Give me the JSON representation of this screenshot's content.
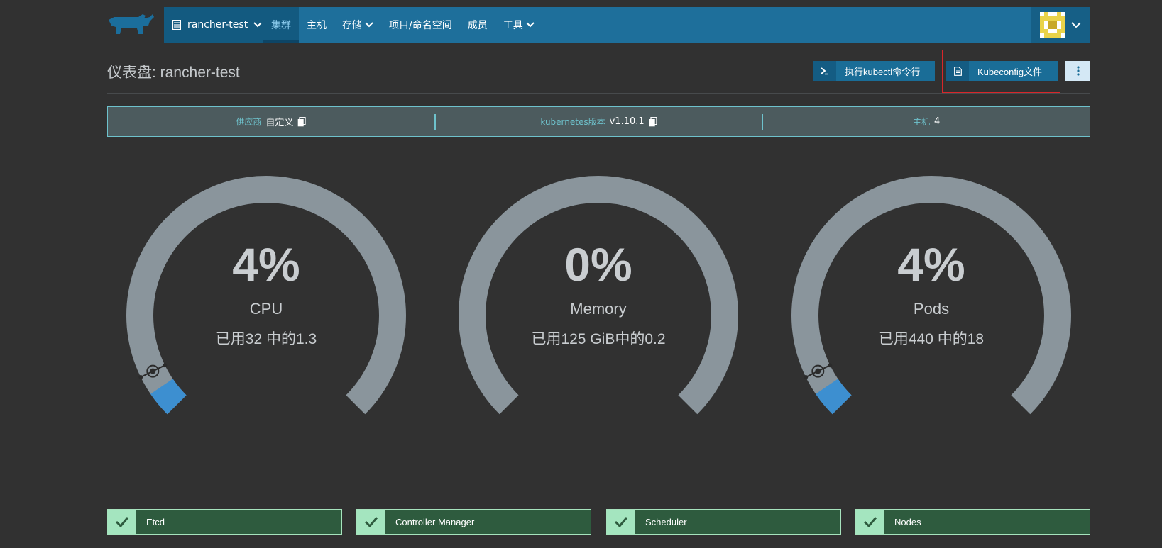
{
  "nav": {
    "cluster": "rancher-test",
    "items": [
      {
        "label": "集群",
        "active": true,
        "dropdown": false
      },
      {
        "label": "主机",
        "active": false,
        "dropdown": false
      },
      {
        "label": "存储",
        "active": false,
        "dropdown": true
      },
      {
        "label": "项目/命名空间",
        "active": false,
        "dropdown": false
      },
      {
        "label": "成员",
        "active": false,
        "dropdown": false
      },
      {
        "label": "工具",
        "active": false,
        "dropdown": true
      }
    ]
  },
  "header": {
    "title": "仪表盘: rancher-test",
    "kubectl_label": "执行kubectl命令行",
    "kubeconfig_label": "Kubeconfig文件"
  },
  "info": {
    "provider_label": "供应商",
    "provider_value": "自定义",
    "k8s_label": "kubernetes版本",
    "k8s_value": "v1.10.1",
    "hosts_label": "主机",
    "hosts_value": "4"
  },
  "gauges": [
    {
      "percent_text": "4%",
      "name": "CPU",
      "detail": "已用32 中的1.3",
      "fraction": 0.04
    },
    {
      "percent_text": "0%",
      "name": "Memory",
      "detail": "已用125 GiB中的0.2",
      "fraction": 0.0
    },
    {
      "percent_text": "4%",
      "name": "Pods",
      "detail": "已用440 中的18",
      "fraction": 0.04
    }
  ],
  "status": [
    {
      "label": "Etcd",
      "ok": true
    },
    {
      "label": "Controller Manager",
      "ok": true
    },
    {
      "label": "Scheduler",
      "ok": true
    },
    {
      "label": "Nodes",
      "ok": true
    }
  ],
  "colors": {
    "background": "#313131",
    "nav": "#1e6f9b",
    "gauge_track": "#8a959c",
    "gauge_fill": "#3d8fd0",
    "status_bg": "#2e5b3e",
    "status_check": "#a4e5bf",
    "highlight": "#d9262a"
  }
}
